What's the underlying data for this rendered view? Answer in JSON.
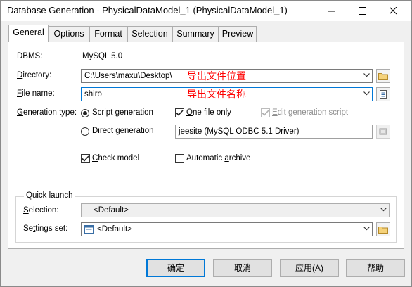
{
  "window": {
    "title": "Database Generation - PhysicalDataModel_1 (PhysicalDataModel_1)"
  },
  "tabs": [
    {
      "label": "General",
      "active": true
    },
    {
      "label": "Options"
    },
    {
      "label": "Format"
    },
    {
      "label": "Selection"
    },
    {
      "label": "Summary"
    },
    {
      "label": "Preview"
    }
  ],
  "general": {
    "dbms_label": "DBMS:",
    "dbms_value": "MySQL 5.0",
    "directory_label": "Directory:",
    "directory_value": "C:\\Users\\maxu\\Desktop\\",
    "directory_annotation": "导出文件位置",
    "filename_label": "File name:",
    "filename_value": "shiro",
    "filename_annotation": "导出文件名称",
    "generation_type_label": "Generation type:",
    "script_generation": "Script generation",
    "direct_generation": "Direct generation",
    "one_file_only": "One file only",
    "edit_generation_script": "Edit generation script",
    "data_source": "jeesite (MySQL ODBC 5.1 Driver)",
    "check_model": "Check model",
    "automatic_archive": "Automatic archive"
  },
  "state": {
    "generation_type": "script",
    "one_file_only": true,
    "edit_generation_script": true,
    "edit_generation_script_disabled": true,
    "check_model": true,
    "automatic_archive": false
  },
  "quick_launch": {
    "legend": "Quick launch",
    "selection_label": "Selection:",
    "selection_value": "<Default>",
    "settings_label": "Settings set:",
    "settings_value": "<Default>"
  },
  "buttons": {
    "ok": "确定",
    "cancel": "取消",
    "apply": "应用(A)",
    "help": "帮助"
  },
  "colors": {
    "annotation": "#ff0000",
    "focus_border": "#0078d7",
    "dialog_bg": "#f0f0f0"
  }
}
